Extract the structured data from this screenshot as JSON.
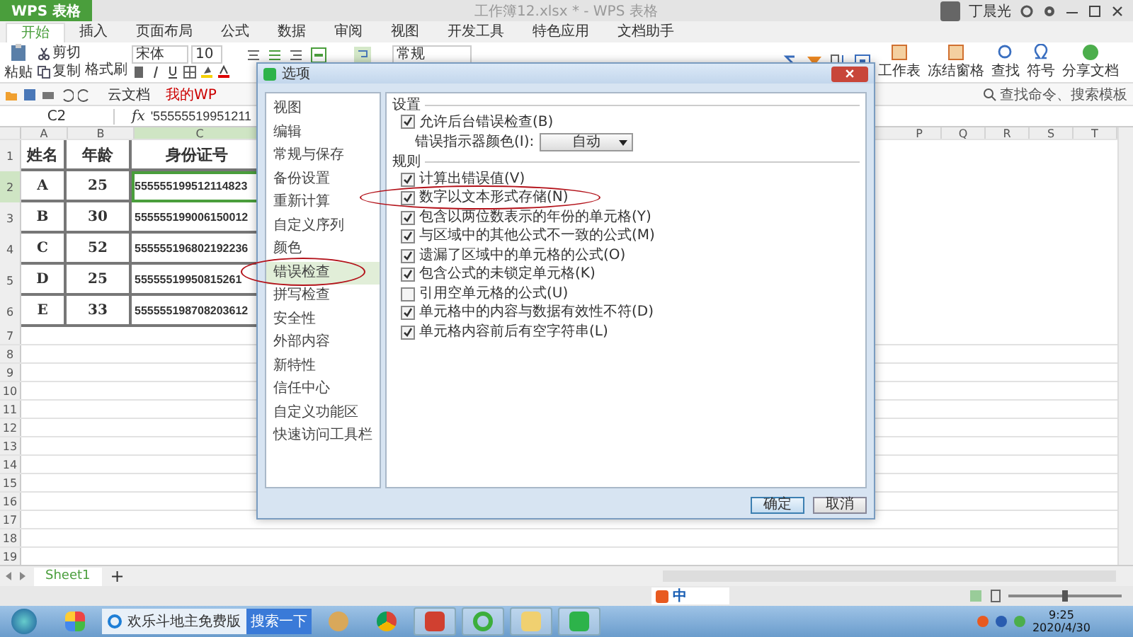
{
  "app": {
    "menu_button": "WPS 表格",
    "doc_title": "工作簿12.xlsx * - WPS 表格",
    "user": "丁晨光"
  },
  "tabs": [
    {
      "label": "开始",
      "selected": true
    },
    {
      "label": "插入",
      "selected": false
    },
    {
      "label": "页面布局",
      "selected": false
    },
    {
      "label": "公式",
      "selected": false
    },
    {
      "label": "数据",
      "selected": false
    },
    {
      "label": "审阅",
      "selected": false
    },
    {
      "label": "视图",
      "selected": false
    },
    {
      "label": "开发工具",
      "selected": false
    },
    {
      "label": "特色应用",
      "selected": false
    },
    {
      "label": "文档助手",
      "selected": false
    }
  ],
  "ribbon": {
    "paste": "粘贴",
    "cut": "剪切",
    "copy": "复制",
    "format_painter": "格式刷",
    "font": "宋体",
    "font_size": "10",
    "number_format": "常规",
    "right_buttons": [
      "工作表",
      "冻结窗格",
      "查找",
      "符号",
      "分享文档"
    ]
  },
  "quick_bar": {
    "cloud": "云文档",
    "my_wps": "我的WP",
    "search_placeholder": "查找命令、搜索模板"
  },
  "formula_bar": {
    "cell_ref": "C2",
    "fx": "fx",
    "value": "'55555519951211"
  },
  "columns_left": [
    {
      "label": "A",
      "selected": false
    },
    {
      "label": "B",
      "selected": false
    },
    {
      "label": "C",
      "selected": true
    }
  ],
  "columns_right": [
    {
      "label": "P",
      "selected": false
    },
    {
      "label": "Q",
      "selected": false
    },
    {
      "label": "R",
      "selected": false
    },
    {
      "label": "S",
      "selected": false
    },
    {
      "label": "T",
      "selected": false
    }
  ],
  "rows": [
    {
      "number": "1",
      "selected": false,
      "cells": [
        "姓名",
        "年龄",
        "身份证号"
      ]
    },
    {
      "number": "2",
      "selected": true,
      "cells": [
        "A",
        "25",
        "555555199512114823"
      ]
    },
    {
      "number": "3",
      "selected": false,
      "cells": [
        "B",
        "30",
        "555555199006150012"
      ]
    },
    {
      "number": "4",
      "selected": false,
      "cells": [
        "C",
        "52",
        "555555196802192236"
      ]
    },
    {
      "number": "5",
      "selected": false,
      "cells": [
        "D",
        "25",
        "55555519950815261"
      ]
    },
    {
      "number": "6",
      "selected": false,
      "cells": [
        "E",
        "33",
        "555555198708203612"
      ]
    }
  ],
  "empty_rows": [
    "7",
    "8",
    "9",
    "10",
    "11",
    "12",
    "13",
    "14",
    "15",
    "16",
    "17",
    "18",
    "19"
  ],
  "sheet_tabs": [
    {
      "label": "Sheet1",
      "selected": true
    }
  ],
  "add_sheet": "+",
  "ime_bar": {
    "mode": "中"
  },
  "zoom": {
    "level": 0.5
  },
  "dialog": {
    "title": "选项",
    "nav": [
      {
        "label": "视图",
        "selected": false
      },
      {
        "label": "编辑",
        "selected": false
      },
      {
        "label": "常规与保存",
        "selected": false
      },
      {
        "label": "备份设置",
        "selected": false
      },
      {
        "label": "重新计算",
        "selected": false
      },
      {
        "label": "自定义序列",
        "selected": false
      },
      {
        "label": "颜色",
        "selected": false
      },
      {
        "label": "错误检查",
        "selected": true
      },
      {
        "label": "拼写检查",
        "selected": false
      },
      {
        "label": "安全性",
        "selected": false
      },
      {
        "label": "外部内容",
        "selected": false
      },
      {
        "label": "新特性",
        "selected": false
      },
      {
        "label": "信任中心",
        "selected": false
      },
      {
        "label": "自定义功能区",
        "selected": false
      },
      {
        "label": "快速访问工具栏",
        "selected": false
      }
    ],
    "settings_heading": "设置",
    "background_check": {
      "label": "允许后台错误检查(B)",
      "checked": true
    },
    "color_label": "错误指示器颜色(I):",
    "color_value": "自动",
    "rules_heading": "规则",
    "rules": [
      {
        "label": "计算出错误值(V)",
        "checked": true
      },
      {
        "label": "数字以文本形式存储(N)",
        "checked": true
      },
      {
        "label": "包含以两位数表示的年份的单元格(Y)",
        "checked": true
      },
      {
        "label": "与区域中的其他公式不一致的公式(M)",
        "checked": true
      },
      {
        "label": "遗漏了区域中的单元格的公式(O)",
        "checked": true
      },
      {
        "label": "包含公式的未锁定单元格(K)",
        "checked": true
      },
      {
        "label": "引用空单元格的公式(U)",
        "checked": false
      },
      {
        "label": "单元格中的内容与数据有效性不符(D)",
        "checked": true
      },
      {
        "label": "单元格内容前后有空字符串(L)",
        "checked": true
      }
    ],
    "buttons": [
      "确定",
      "取消"
    ]
  },
  "taskbar": {
    "browser_tab": "欢乐斗地主免费版",
    "search_button": "搜索一下",
    "time": "9:25",
    "date": "2020/4/30"
  }
}
